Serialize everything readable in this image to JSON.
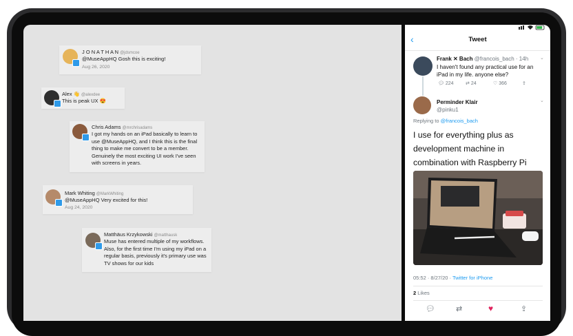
{
  "cards": [
    {
      "name": "J O N A T H A N",
      "handle": "@jdsmcoe",
      "text": "@MuseAppHQ Gosh this is exciting!",
      "date": "Aug 26, 2020"
    },
    {
      "name": "Alex 👋",
      "handle": "@alexdee",
      "text": "This is peak UX 😍"
    },
    {
      "name": "Chris Adams",
      "handle": "@mrchrisadams",
      "text": "I got my hands on an iPad basically to learn to use @MuseAppHQ, and I think this is the final thing to make me convert to be a member. Genuinely the most exciting UI work I've seen with screens in years."
    },
    {
      "name": "Mark Whiting",
      "handle": "@MarkWhiting",
      "text": "@MuseAppHQ Very excited for this!",
      "date": "Aug 24, 2020"
    },
    {
      "name": "Matthäus Krzykowski",
      "handle": "@matthausk",
      "text": "Muse has entered multiple of my workflows. Also, for the first time I'm using my iPad on a regular basis, previously it's primary use was TV shows for our kids"
    }
  ],
  "tweet_panel": {
    "title": "Tweet",
    "parent": {
      "name": "Frank ✕ Bach",
      "handle": "@francois_bach",
      "time": "· 14h",
      "text": "I haven't found any practical use for an iPad in my life. anyone else?",
      "replies": "224",
      "retweets": "24",
      "likes": "366"
    },
    "reply": {
      "name": "Perminder Klair",
      "handle": "@pinku1",
      "replying_label": "Replying to",
      "replying_to": "@francois_bach",
      "text": "I use for everything plus as development machine in combination with Raspberry Pi",
      "time": "05:52 · 8/27/20 · ",
      "source": "Twitter for iPhone",
      "likes_count": "2",
      "likes_label": "Likes"
    }
  },
  "colors": {
    "accent": "#1d9bf0",
    "like": "#e0245e",
    "canvas": "#e3e3e3"
  }
}
